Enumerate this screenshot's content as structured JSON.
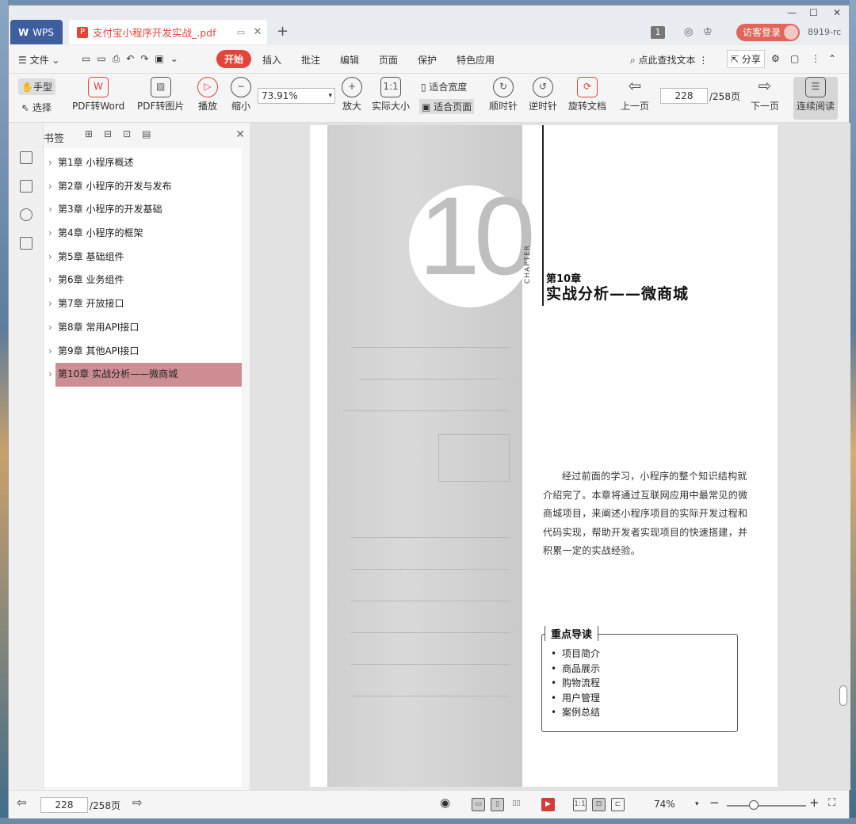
{
  "app": {
    "name": "WPS",
    "doc_tab": "支付宝小程序开发实战_.pdf",
    "guest_login": "访客登录",
    "user_id": "8919-rc",
    "notif_count": "1"
  },
  "menu": {
    "file": "文件",
    "tabs": [
      "开始",
      "插入",
      "批注",
      "编辑",
      "页面",
      "保护",
      "特色应用"
    ],
    "search": "点此查找文本",
    "share": "分享"
  },
  "toolbar": {
    "hand": "手型",
    "select": "选择",
    "pdf_word": "PDF转Word",
    "pdf_img": "PDF转图片",
    "play": "播放",
    "zoom_out": "缩小",
    "zoom_value": "73.91%",
    "zoom_in": "放大",
    "actual": "实际大小",
    "fit_width": "适合宽度",
    "fit_page": "适合页面",
    "clockwise": "顺时针",
    "counter": "逆时针",
    "rotate": "旋转文档",
    "prev": "上一页",
    "page": "228",
    "page_total": "/258页",
    "next": "下一页",
    "continuous": "连续阅读"
  },
  "bookmarks": {
    "title": "书签",
    "items": [
      "第1章 小程序概述",
      "第2章 小程序的开发与发布",
      "第3章 小程序的开发基础",
      "第4章 小程序的框架",
      "第5章 基础组件",
      "第6章 业务组件",
      "第7章 开放接口",
      "第8章 常用API接口",
      "第9章 其他API接口",
      "第10章 实战分析——微商城"
    ],
    "selected_index": 9
  },
  "page": {
    "big_number": "10",
    "chapter_word": "CHAPTER",
    "chapter_no": "第10章",
    "chapter_title": "实战分析——微商城",
    "intro": "经过前面的学习，小程序的整个知识结构就介绍完了。本章将通过互联网应用中最常见的微商城项目，来阐述小程序项目的实际开发过程和代码实现，帮助开发者实现项目的快速搭建，并积累一定的实战经验。",
    "key_title": "重点导读",
    "key_items": [
      "项目简介",
      "商品展示",
      "购物流程",
      "用户管理",
      "案例总结"
    ]
  },
  "status": {
    "page": "228",
    "page_total": "/258页",
    "zoom": "74%"
  },
  "colors": {
    "accent": "#e4453a",
    "wps_tab": "#3f5ea0",
    "selected_bookmark": "#cc8e93"
  }
}
